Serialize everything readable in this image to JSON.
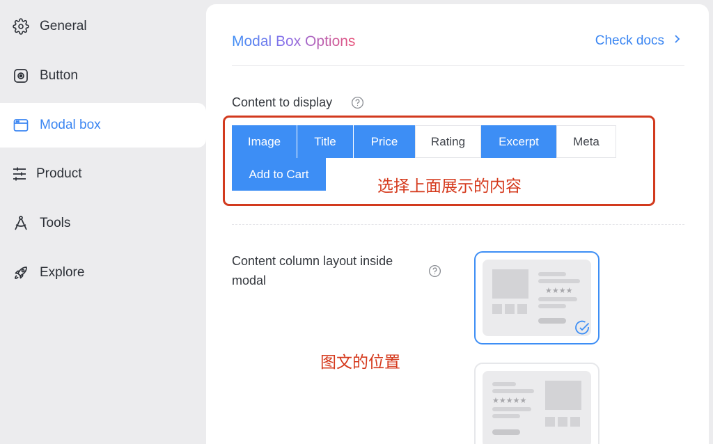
{
  "sidebar": {
    "items": [
      {
        "label": "General",
        "icon": "gear-icon"
      },
      {
        "label": "Button",
        "icon": "button-icon"
      },
      {
        "label": "Modal box",
        "icon": "window-icon",
        "active": true
      },
      {
        "label": "Product",
        "icon": "sliders-icon"
      },
      {
        "label": "Tools",
        "icon": "compass-icon"
      },
      {
        "label": "Explore",
        "icon": "rocket-icon"
      }
    ]
  },
  "main": {
    "title": "Modal Box Options",
    "check_docs": "Check docs",
    "content_display": {
      "label": "Content to display",
      "options": [
        {
          "label": "Image",
          "selected": true
        },
        {
          "label": "Title",
          "selected": true
        },
        {
          "label": "Price",
          "selected": true
        },
        {
          "label": "Rating",
          "selected": false
        },
        {
          "label": "Excerpt",
          "selected": true
        },
        {
          "label": "Meta",
          "selected": false
        },
        {
          "label": "Add to Cart",
          "selected": true
        }
      ]
    },
    "layout": {
      "label": "Content column layout inside modal",
      "options": [
        {
          "name": "image-left",
          "selected": true,
          "stars": "★★★★"
        },
        {
          "name": "image-right",
          "selected": false,
          "stars": "★★★★★"
        }
      ]
    }
  },
  "annotations": {
    "content_note": "选择上面展示的内容",
    "layout_note": "图文的位置"
  },
  "colors": {
    "accent": "#3d8ef5",
    "annotation": "#d23a1e",
    "sidebar_bg": "#ececee"
  }
}
